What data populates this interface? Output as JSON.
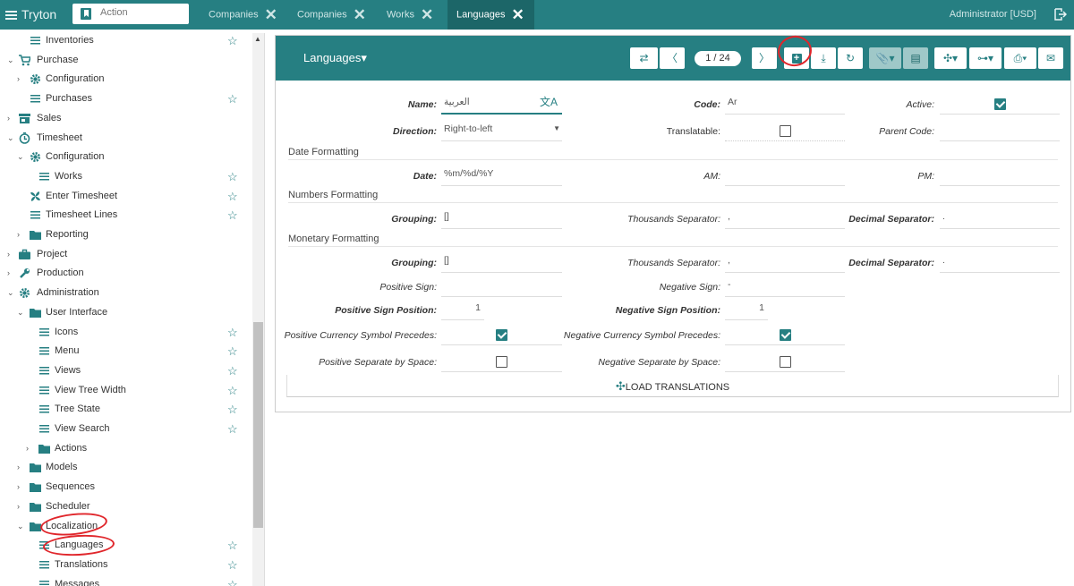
{
  "app": {
    "name": "Tryton",
    "user": "Administrator [USD]"
  },
  "action_search": {
    "placeholder": "Action"
  },
  "tabs": [
    {
      "label": "Companies"
    },
    {
      "label": "Companies"
    },
    {
      "label": "Works"
    },
    {
      "label": "Languages"
    }
  ],
  "sidebar": {
    "items": [
      {
        "label": "Inventories"
      },
      {
        "label": "Purchase"
      },
      {
        "label": "Configuration"
      },
      {
        "label": "Purchases"
      },
      {
        "label": "Sales"
      },
      {
        "label": "Timesheet"
      },
      {
        "label": "Configuration"
      },
      {
        "label": "Works"
      },
      {
        "label": "Enter Timesheet"
      },
      {
        "label": "Timesheet Lines"
      },
      {
        "label": "Reporting"
      },
      {
        "label": "Project"
      },
      {
        "label": "Production"
      },
      {
        "label": "Administration"
      },
      {
        "label": "User Interface"
      },
      {
        "label": "Icons"
      },
      {
        "label": "Menu"
      },
      {
        "label": "Views"
      },
      {
        "label": "View Tree Width"
      },
      {
        "label": "Tree State"
      },
      {
        "label": "View Search"
      },
      {
        "label": "Actions"
      },
      {
        "label": "Models"
      },
      {
        "label": "Sequences"
      },
      {
        "label": "Scheduler"
      },
      {
        "label": "Localization"
      },
      {
        "label": "Languages"
      },
      {
        "label": "Translations"
      },
      {
        "label": "Messages"
      }
    ]
  },
  "form": {
    "title": "Languages",
    "pager": "1 / 24",
    "name_label": "Name:",
    "name_value": "العربية",
    "code_label": "Code:",
    "code_value": "Ar",
    "active_label": "Active:",
    "direction_label": "Direction:",
    "direction_value": "Right-to-left",
    "translatable_label": "Translatable:",
    "parent_code_label": "Parent Code:",
    "date_section": "Date Formatting",
    "date_label": "Date:",
    "date_value": "%m/%d/%Y",
    "am_label": "AM:",
    "pm_label": "PM:",
    "numbers_section": "Numbers Formatting",
    "grouping_label": "Grouping:",
    "grouping_value": "[]",
    "thousands_label": "Thousands Separator:",
    "thousands_value": ",",
    "decimal_label": "Decimal Separator:",
    "decimal_value": ".",
    "monetary_section": "Monetary Formatting",
    "m_grouping_value": "[]",
    "m_thousands_value": ",",
    "m_decimal_value": ".",
    "pos_sign_label": "Positive Sign:",
    "neg_sign_label": "Negative Sign:",
    "neg_sign_value": "-",
    "pos_sign_pos_label": "Positive Sign Position:",
    "pos_sign_pos_value": "1",
    "neg_sign_pos_label": "Negative Sign Position:",
    "neg_sign_pos_value": "1",
    "pos_cur_label": "Positive Currency Symbol Precedes:",
    "neg_cur_label": "Negative Currency Symbol Precedes:",
    "pos_sep_label": "Positive Separate by Space:",
    "neg_sep_label": "Negative Separate by Space:",
    "load_label": "LOAD TRANSLATIONS"
  },
  "colors": {
    "accent": "#267f82",
    "annotation": "#e0262b"
  }
}
